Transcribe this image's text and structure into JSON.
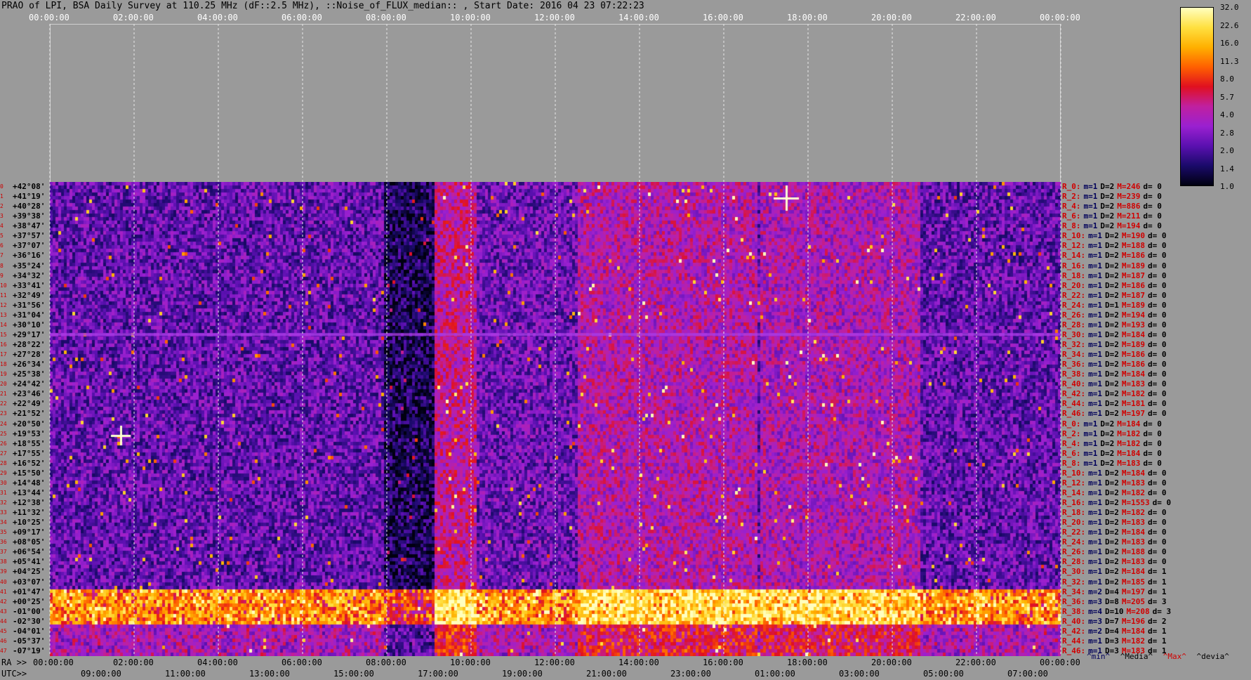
{
  "title": "PRAO of LPI, BSA Daily Survey at 110.25 MHz (dF::2.5 MHz), ::Noise_of_FLUX_median:: , Start Date: 2016 04 23 07:22:23",
  "chart_data": {
    "type": "heatmap",
    "top_axis_ticks": [
      "00:00:00",
      "02:00:00",
      "04:00:00",
      "06:00:00",
      "08:00:00",
      "10:00:00",
      "12:00:00",
      "14:00:00",
      "16:00:00",
      "18:00:00",
      "20:00:00",
      "22:00:00",
      "00:00:00"
    ],
    "ra_axis": {
      "prefix": "RA >>",
      "ticks": [
        "00:00:00",
        "02:00:00",
        "04:00:00",
        "06:00:00",
        "08:00:00",
        "10:00:00",
        "12:00:00",
        "14:00:00",
        "16:00:00",
        "18:00:00",
        "20:00:00",
        "22:00:00",
        "00:00:00"
      ]
    },
    "utc_axis": {
      "prefix": "UTC>>",
      "ticks": [
        "09:00:00",
        "11:00:00",
        "13:00:00",
        "15:00:00",
        "17:00:00",
        "19:00:00",
        "21:00:00",
        "23:00:00",
        "01:00:00",
        "03:00:00",
        "05:00:00",
        "07:00:00"
      ]
    },
    "colorbar": {
      "ticks": [
        "32.0",
        "22.6",
        "16.0",
        "11.3",
        "8.0",
        "5.7",
        "4.0",
        "2.8",
        "2.0",
        "1.4",
        "1.0"
      ],
      "scale": "log",
      "range": [
        1.0,
        32.0
      ],
      "colors": [
        "#000010",
        "#1a0a6a",
        "#5a10b0",
        "#9a20d0",
        "#c020a0",
        "#e01020",
        "#ff6000",
        "#ffb000",
        "#ffe040",
        "#ffffc0"
      ]
    },
    "declinations": [
      "+42°08'",
      "+41°19'",
      "+40°28'",
      "+39°38'",
      "+38°47'",
      "+37°57'",
      "+37°07'",
      "+36°16'",
      "+35°24'",
      "+34°32'",
      "+33°41'",
      "+32°49'",
      "+31°56'",
      "+31°04'",
      "+30°10'",
      "+29°17'",
      "+28°22'",
      "+27°28'",
      "+26°34'",
      "+25°38'",
      "+24°42'",
      "+23°46'",
      "+22°49'",
      "+21°52'",
      "+20°50'",
      "+19°53'",
      "+18°55'",
      "+17°55'",
      "+16°52'",
      "+15°50'",
      "+14°48'",
      "+13°44'",
      "+12°38'",
      "+11°32'",
      "+10°25'",
      "+09°17'",
      "+08°05'",
      "+06°54'",
      "+05°41'",
      "+04°25'",
      "+03°07'",
      "+01°47'",
      "+00°25'",
      "-01°00'",
      "-02°30'",
      "-04°01'",
      "-05°37'",
      "-07°19'"
    ],
    "row_stats": [
      {
        "r": "R_0:",
        "m": "m=1",
        "d": "D=2",
        "M": "M=246",
        "dv": "d= 0"
      },
      {
        "r": "R_2:",
        "m": "m=1",
        "d": "D=2",
        "M": "M=239",
        "dv": "d= 0"
      },
      {
        "r": "R_4:",
        "m": "m=1",
        "d": "D=2",
        "M": "M=886",
        "dv": "d= 0"
      },
      {
        "r": "R_6:",
        "m": "m=1",
        "d": "D=2",
        "M": "M=211",
        "dv": "d= 0"
      },
      {
        "r": "R_8:",
        "m": "m=1",
        "d": "D=2",
        "M": "M=194",
        "dv": "d= 0"
      },
      {
        "r": "R_10:",
        "m": "m=1",
        "d": "D=2",
        "M": "M=190",
        "dv": "d= 0"
      },
      {
        "r": "R_12:",
        "m": "m=1",
        "d": "D=2",
        "M": "M=188",
        "dv": "d= 0"
      },
      {
        "r": "R_14:",
        "m": "m=1",
        "d": "D=2",
        "M": "M=186",
        "dv": "d= 0"
      },
      {
        "r": "R_16:",
        "m": "m=1",
        "d": "D=2",
        "M": "M=189",
        "dv": "d= 0"
      },
      {
        "r": "R_18:",
        "m": "m=1",
        "d": "D=2",
        "M": "M=187",
        "dv": "d= 0"
      },
      {
        "r": "R_20:",
        "m": "m=1",
        "d": "D=2",
        "M": "M=186",
        "dv": "d= 0"
      },
      {
        "r": "R_22:",
        "m": "m=1",
        "d": "D=2",
        "M": "M=187",
        "dv": "d= 0"
      },
      {
        "r": "R_24:",
        "m": "m=1",
        "d": "D=1",
        "M": "M=189",
        "dv": "d= 0"
      },
      {
        "r": "R_26:",
        "m": "m=1",
        "d": "D=2",
        "M": "M=194",
        "dv": "d= 0"
      },
      {
        "r": "R_28:",
        "m": "m=1",
        "d": "D=2",
        "M": "M=193",
        "dv": "d= 0"
      },
      {
        "r": "R_30:",
        "m": "m=1",
        "d": "D=2",
        "M": "M=184",
        "dv": "d= 0"
      },
      {
        "r": "R_32:",
        "m": "m=1",
        "d": "D=2",
        "M": "M=189",
        "dv": "d= 0"
      },
      {
        "r": "R_34:",
        "m": "m=1",
        "d": "D=2",
        "M": "M=186",
        "dv": "d= 0"
      },
      {
        "r": "R_36:",
        "m": "m=1",
        "d": "D=2",
        "M": "M=186",
        "dv": "d= 0"
      },
      {
        "r": "R_38:",
        "m": "m=1",
        "d": "D=2",
        "M": "M=184",
        "dv": "d= 0"
      },
      {
        "r": "R_40:",
        "m": "m=1",
        "d": "D=2",
        "M": "M=183",
        "dv": "d= 0"
      },
      {
        "r": "R_42:",
        "m": "m=1",
        "d": "D=2",
        "M": "M=182",
        "dv": "d= 0"
      },
      {
        "r": "R_44:",
        "m": "m=1",
        "d": "D=2",
        "M": "M=181",
        "dv": "d= 0"
      },
      {
        "r": "R_46:",
        "m": "m=1",
        "d": "D=2",
        "M": "M=197",
        "dv": "d= 0"
      },
      {
        "r": "R_0:",
        "m": "m=1",
        "d": "D=2",
        "M": "M=184",
        "dv": "d= 0"
      },
      {
        "r": "R_2:",
        "m": "m=1",
        "d": "D=2",
        "M": "M=182",
        "dv": "d= 0"
      },
      {
        "r": "R_4:",
        "m": "m=1",
        "d": "D=2",
        "M": "M=182",
        "dv": "d= 0"
      },
      {
        "r": "R_6:",
        "m": "m=1",
        "d": "D=2",
        "M": "M=184",
        "dv": "d= 0"
      },
      {
        "r": "R_8:",
        "m": "m=1",
        "d": "D=2",
        "M": "M=183",
        "dv": "d= 0"
      },
      {
        "r": "R_10:",
        "m": "m=1",
        "d": "D=2",
        "M": "M=184",
        "dv": "d= 0"
      },
      {
        "r": "R_12:",
        "m": "m=1",
        "d": "D=2",
        "M": "M=183",
        "dv": "d= 0"
      },
      {
        "r": "R_14:",
        "m": "m=1",
        "d": "D=2",
        "M": "M=182",
        "dv": "d= 0"
      },
      {
        "r": "R_16:",
        "m": "m=1",
        "d": "D=2",
        "M": "M=1553",
        "dv": "d= 0"
      },
      {
        "r": "R_18:",
        "m": "m=1",
        "d": "D=2",
        "M": "M=182",
        "dv": "d= 0"
      },
      {
        "r": "R_20:",
        "m": "m=1",
        "d": "D=2",
        "M": "M=183",
        "dv": "d= 0"
      },
      {
        "r": "R_22:",
        "m": "m=1",
        "d": "D=2",
        "M": "M=184",
        "dv": "d= 0"
      },
      {
        "r": "R_24:",
        "m": "m=1",
        "d": "D=2",
        "M": "M=183",
        "dv": "d= 0"
      },
      {
        "r": "R_26:",
        "m": "m=1",
        "d": "D=2",
        "M": "M=188",
        "dv": "d= 0"
      },
      {
        "r": "R_28:",
        "m": "m=1",
        "d": "D=2",
        "M": "M=183",
        "dv": "d= 0"
      },
      {
        "r": "R_30:",
        "m": "m=1",
        "d": "D=2",
        "M": "M=184",
        "dv": "d= 1"
      },
      {
        "r": "R_32:",
        "m": "m=1",
        "d": "D=2",
        "M": "M=185",
        "dv": "d= 1"
      },
      {
        "r": "R_34:",
        "m": "m=2",
        "d": "D=4",
        "M": "M=197",
        "dv": "d= 1"
      },
      {
        "r": "R_36:",
        "m": "m=3",
        "d": "D=8",
        "M": "M=205",
        "dv": "d= 3"
      },
      {
        "r": "R_38:",
        "m": "m=4",
        "d": "D=10",
        "M": "M=208",
        "dv": "d= 3"
      },
      {
        "r": "R_40:",
        "m": "m=3",
        "d": "D=7",
        "M": "M=196",
        "dv": "d= 2"
      },
      {
        "r": "R_42:",
        "m": "m=2",
        "d": "D=4",
        "M": "M=184",
        "dv": "d= 1"
      },
      {
        "r": "R_44:",
        "m": "m=1",
        "d": "D=3",
        "M": "M=182",
        "dv": "d= 1"
      },
      {
        "r": "R_46:",
        "m": "m=1",
        "d": "D=3",
        "M": "M=183",
        "dv": "d= 1"
      }
    ],
    "legend": {
      "min": "^min^",
      "media": "^Media^",
      "max": "^Max^",
      "devia": "^devia^"
    },
    "legend_colors": {
      "min": "#00005a",
      "media": "#000000",
      "max": "#d00000",
      "devia": "#000000"
    }
  }
}
